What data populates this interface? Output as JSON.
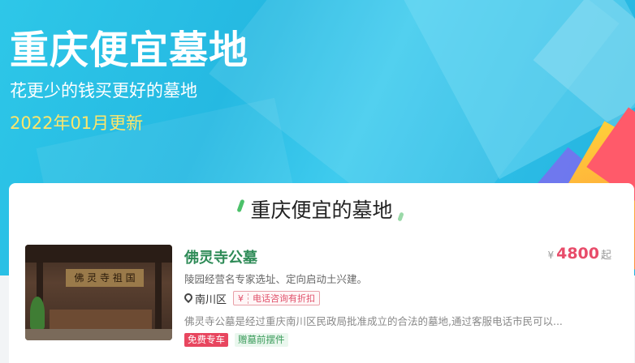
{
  "hero": {
    "title": "重庆便宜墓地",
    "subtitle": "花更少的钱买更好的墓地",
    "update": "2022年01月更新"
  },
  "section": {
    "title": "重庆便宜的墓地"
  },
  "listing": {
    "name": "佛灵寺公墓",
    "price_currency": "¥",
    "price_value": "4800",
    "price_unit": "起",
    "tagline": "陵园经营名专家选址、定向启动土兴建。",
    "district": "南川区",
    "coupon_symbol": "¥",
    "coupon_text": "电话咨询有折扣",
    "description": "佛灵寺公墓是经过重庆南川区民政局批准成立的合法的墓地,通过客服电话市民可以...",
    "image_plaque": "佛 灵 寺 祖 国",
    "tags": [
      "免费专车",
      "赠墓前摆件"
    ]
  },
  "icons": {
    "location": "location-pin-icon"
  },
  "colors": {
    "accent_green": "#2e8b57",
    "price_red": "#e84c6a",
    "hero_blue": "#25b9e2",
    "date_yellow": "#ffe66a"
  }
}
